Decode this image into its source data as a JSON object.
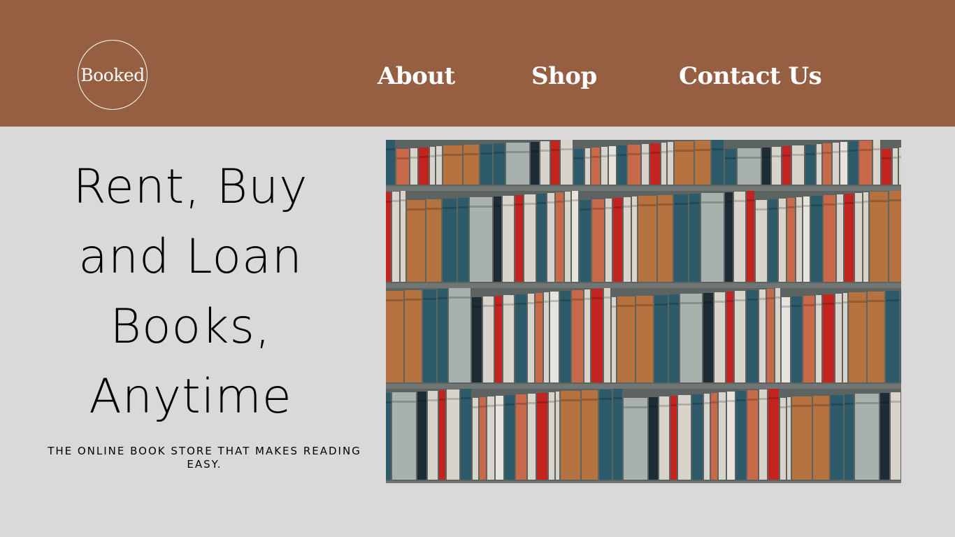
{
  "header": {
    "logo_text": "Booked",
    "nav": [
      {
        "label": "About"
      },
      {
        "label": "Shop"
      },
      {
        "label": "Contact Us"
      }
    ],
    "background_color": "#975f42"
  },
  "hero": {
    "headline_lines": [
      "Rent, Buy",
      "and Loan",
      "Books,",
      "Anytime"
    ],
    "tagline": "THE ONLINE BOOK STORE THAT MAKES READING EASY.",
    "image_subject": "bookshelf-photo"
  },
  "colors": {
    "page_background": "#d9d9d9",
    "book_palette": [
      "#2e5b6a",
      "#c86a4a",
      "#d8d4cc",
      "#a8b1ad",
      "#b5713e",
      "#c4241f",
      "#1e2c36",
      "#e7e4dd"
    ]
  }
}
